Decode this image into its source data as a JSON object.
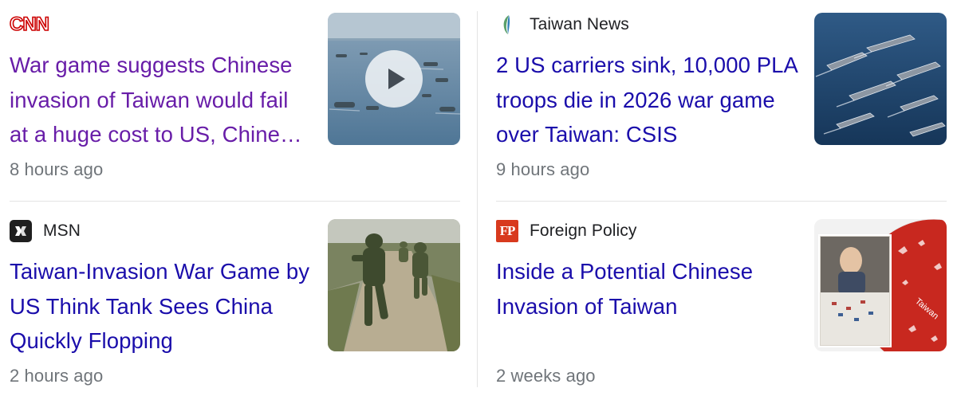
{
  "articles": [
    {
      "source": "CNN",
      "source_logo": "cnn-logo",
      "headline": "War game suggests Chinese invasion of Taiwan would fail at a huge cost to US, Chinese and Taiwanese militaries, Japanese economy",
      "time": "8 hours ago",
      "visited": true,
      "has_video": true,
      "thumbnail": "amphibious-vehicles-at-sea"
    },
    {
      "source": "Taiwan News",
      "source_logo": "taiwan-news-logo",
      "headline": "2 US carriers sink, 10,000 PLA troops die in 2026 war game over Taiwan: CSIS",
      "time": "9 hours ago",
      "visited": false,
      "thumbnail": "aircraft-carrier-fleet"
    },
    {
      "source": "MSN",
      "source_logo": "msn-logo",
      "headline": "Taiwan-Invasion War Game by US Think Tank Sees China Quickly Flopping",
      "time": "2 hours ago",
      "visited": false,
      "thumbnail": "soldiers-running-on-road"
    },
    {
      "source": "Foreign Policy",
      "source_logo": "foreign-policy-logo",
      "headline": "Inside a Potential Chinese Invasion of Taiwan",
      "time": "2 weeks ago",
      "visited": false,
      "thumbnail": "war-game-board-taiwan"
    }
  ],
  "logos": {
    "cnn_text": "CNN",
    "fp_text": "FP",
    "board_label": "Taiwan"
  },
  "colors": {
    "link": "#1a0dab",
    "visited_link": "#681da8",
    "meta": "#70757a",
    "cnn_red": "#cc0000",
    "fp_red": "#d83a1e"
  }
}
